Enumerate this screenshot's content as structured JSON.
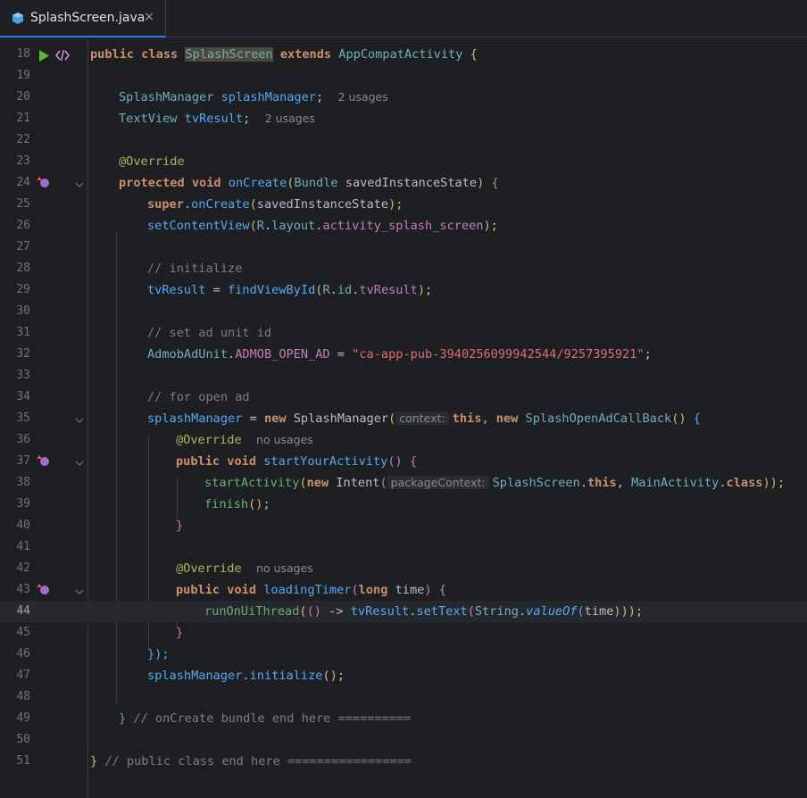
{
  "tab": {
    "title": "SplashScreen.java",
    "close": "×"
  },
  "colors": {
    "accent": "#3574f0",
    "background": "#1e1f22"
  },
  "lines": [
    {
      "n": "18"
    },
    {
      "n": "19"
    },
    {
      "n": "20"
    },
    {
      "n": "21"
    },
    {
      "n": "22"
    },
    {
      "n": "23"
    },
    {
      "n": "24"
    },
    {
      "n": "25"
    },
    {
      "n": "26"
    },
    {
      "n": "27"
    },
    {
      "n": "28"
    },
    {
      "n": "29"
    },
    {
      "n": "30"
    },
    {
      "n": "31"
    },
    {
      "n": "32"
    },
    {
      "n": "33"
    },
    {
      "n": "34"
    },
    {
      "n": "35"
    },
    {
      "n": "36"
    },
    {
      "n": "37"
    },
    {
      "n": "38"
    },
    {
      "n": "39"
    },
    {
      "n": "40"
    },
    {
      "n": "41"
    },
    {
      "n": "42"
    },
    {
      "n": "43"
    },
    {
      "n": "44"
    },
    {
      "n": "45"
    },
    {
      "n": "46"
    },
    {
      "n": "47"
    },
    {
      "n": "48"
    },
    {
      "n": "49"
    },
    {
      "n": "50"
    },
    {
      "n": "51"
    }
  ],
  "code": {
    "l18": {
      "public": "public",
      "class": "class",
      "name": "SplashScreen",
      "extends": "extends",
      "parent": "AppCompatActivity",
      "brace": "{"
    },
    "l20": {
      "type": "SplashManager",
      "var": "splashManager",
      "semi": ";",
      "usages": "2 usages"
    },
    "l21": {
      "type": "TextView",
      "var": "tvResult",
      "semi": ";",
      "usages": "2 usages"
    },
    "l23": {
      "ann": "@Override"
    },
    "l24": {
      "protected": "protected",
      "void": "void",
      "fn": "onCreate",
      "open": "(",
      "ptype": "Bundle",
      "pname": "savedInstanceState",
      "close": ")",
      "brace": "{"
    },
    "l25": {
      "super": "super",
      "dot": ".",
      "fn": "onCreate",
      "open": "(",
      "arg": "savedInstanceState",
      "close": ");"
    },
    "l26": {
      "fn": "setContentView",
      "open": "(",
      "r": "R",
      "d1": ".",
      "layout": "layout",
      "d2": ".",
      "field": "activity_splash_screen",
      "close": ");"
    },
    "l28": {
      "comment": "// initialize"
    },
    "l29": {
      "var": "tvResult",
      "eq": " = ",
      "fn": "findViewById",
      "open": "(",
      "r": "R",
      "d1": ".",
      "id": "id",
      "d2": ".",
      "field": "tvResult",
      "close": ");"
    },
    "l31": {
      "comment": "// set ad unit id"
    },
    "l32": {
      "cls": "AdmobAdUnit",
      "dot": ".",
      "field": "ADMOB_OPEN_AD",
      "eq": " = ",
      "str": "\"ca-app-pub-3940256099942544/9257395921\"",
      "semi": ";"
    },
    "l34": {
      "comment": "// for open ad"
    },
    "l35": {
      "var": "splashManager",
      "eq": " = ",
      "new1": "new",
      "type": "SplashManager",
      "open": "(",
      "hint": "context:",
      "this": "this",
      "comma": ", ",
      "new2": "new",
      "cb": "SplashOpenAdCallBack",
      "parens": "()",
      "brace": "{"
    },
    "l36": {
      "ann": "@Override",
      "usages": "no usages"
    },
    "l37": {
      "public": "public",
      "void": "void",
      "fn": "startYourActivity",
      "parens": "()",
      "brace": "{"
    },
    "l38": {
      "fn": "startActivity",
      "open": "(",
      "new": "new",
      "intent": "Intent",
      "open2": "(",
      "hint": "packageContext:",
      "cls": "SplashScreen",
      "dot": ".",
      "this": "this",
      "comma": ", ",
      "main": "MainActivity",
      "dot2": ".",
      "class": "class",
      "close": "));"
    },
    "l39": {
      "fn": "finish",
      "parens": "()",
      "semi": ";"
    },
    "l40": {
      "brace": "}"
    },
    "l42": {
      "ann": "@Override",
      "usages": "no usages"
    },
    "l43": {
      "public": "public",
      "void": "void",
      "fn": "loadingTimer",
      "open": "(",
      "long": "long",
      "pname": "time",
      "close": ")",
      "brace": "{"
    },
    "l44": {
      "fn": "runOnUiThread",
      "open": "(",
      "lp": "()",
      "arrow": " -> ",
      "var": "tvResult",
      "dot": ".",
      "set": "setText",
      "open2": "(",
      "str": "String",
      "dot2": ".",
      "vo": "valueOf",
      "open3": "(",
      "arg": "time",
      "close": ")));"
    },
    "l45": {
      "brace": "}"
    },
    "l46": {
      "close": "});"
    },
    "l47": {
      "var": "splashManager",
      "dot": ".",
      "fn": "initialize",
      "parens": "()",
      "semi": ";"
    },
    "l49": {
      "brace": "}",
      "comment": " // onCreate bundle end here =========="
    },
    "l51": {
      "brace": "}",
      "comment": " // public class end here ================="
    }
  },
  "icons": {
    "file": "java-class-file-icon",
    "run": "run-icon",
    "embed": "code-embed-icon",
    "override": "override-method-icon",
    "fold": "fold-chevron-icon"
  }
}
